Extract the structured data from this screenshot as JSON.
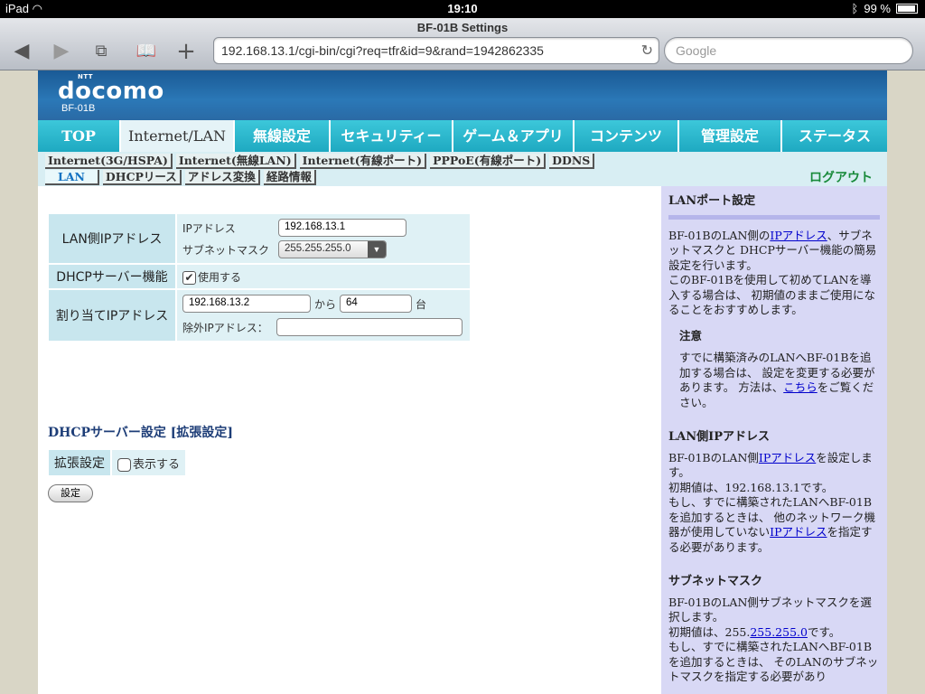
{
  "status_bar": {
    "device": "iPad",
    "time": "19:10",
    "battery": "99 %"
  },
  "browser": {
    "title": "BF-01B Settings",
    "url": "192.168.13.1/cgi-bin/cgi?req=tfr&id=9&rand=1942862335",
    "search_placeholder": "Google"
  },
  "header": {
    "logo_small": "NTT",
    "logo": "docomo",
    "model": "BF-01B"
  },
  "main_nav": [
    "TOP",
    "Internet/LAN",
    "無線設定",
    "セキュリティー",
    "ゲーム＆アプリ",
    "コンテンツ",
    "管理設定",
    "ステータス"
  ],
  "sub_nav_row1": [
    "Internet(3G/HSPA)",
    "Internet(無線LAN)",
    "Internet(有線ポート)",
    "PPPoE(有線ポート)",
    "DDNS"
  ],
  "sub_nav_row2": [
    "LAN",
    "DHCPリース",
    "アドレス変換",
    "経路情報"
  ],
  "logout": "ログアウト",
  "lan": {
    "ip_section_label": "LAN側IPアドレス",
    "ip_label": "IPアドレス",
    "ip_value": "192.168.13.1",
    "subnet_label": "サブネットマスク",
    "subnet_value": "255.255.255.0",
    "dhcp_label": "DHCPサーバー機能",
    "dhcp_checkbox_label": "使用する",
    "alloc_label": "割り当てIPアドレス",
    "alloc_start": "192.168.13.2",
    "alloc_from": "から",
    "alloc_count": "64",
    "alloc_unit": "台",
    "exclude_label": "除外IPアドレス："
  },
  "dhcp_ext": {
    "title": "DHCPサーバー設定 [拡張設定]",
    "row_label": "拡張設定",
    "checkbox_label": "表示する"
  },
  "submit_label": "設定",
  "help": {
    "title": "LANポート設定",
    "intro_1": "BF-01BのLAN側の",
    "intro_link": "IPアドレス",
    "intro_2": "、サブネットマスクと DHCPサーバー機能の簡易設定を行います。",
    "intro_3": "このBF-01Bを使用して初めてLANを導入する場合は、 初期値のままご使用になることをおすすめします。",
    "note_title": "注意",
    "note_1": "すでに構築済みのLANへBF-01Bを追加する場合は、 設定を変更する必要があります。 方法は、",
    "note_link": "こちら",
    "note_2": "をご覧ください。",
    "ip_title": "LAN側IPアドレス",
    "ip_1": "BF-01BのLAN側",
    "ip_link": "IPアドレス",
    "ip_2": "を設定します。",
    "ip_3": "初期値は、192.168.13.1です。",
    "ip_4": "もし、すでに構築されたLANへBF-01Bを追加するときは、 他のネットワーク機器が使用していない",
    "ip_link2": "IPアドレス",
    "ip_5": "を指定する必要があります。",
    "mask_title": "サブネットマスク",
    "mask_1": "BF-01BのLAN側サブネットマスクを選択します。",
    "mask_2": "初期値は、255.",
    "mask_link": "255.255.0",
    "mask_3": "です。",
    "mask_4": "もし、すでに構築されたLANへBF-01Bを追加するときは、 そのLANのサブネットマスクを指定する必要があり"
  }
}
